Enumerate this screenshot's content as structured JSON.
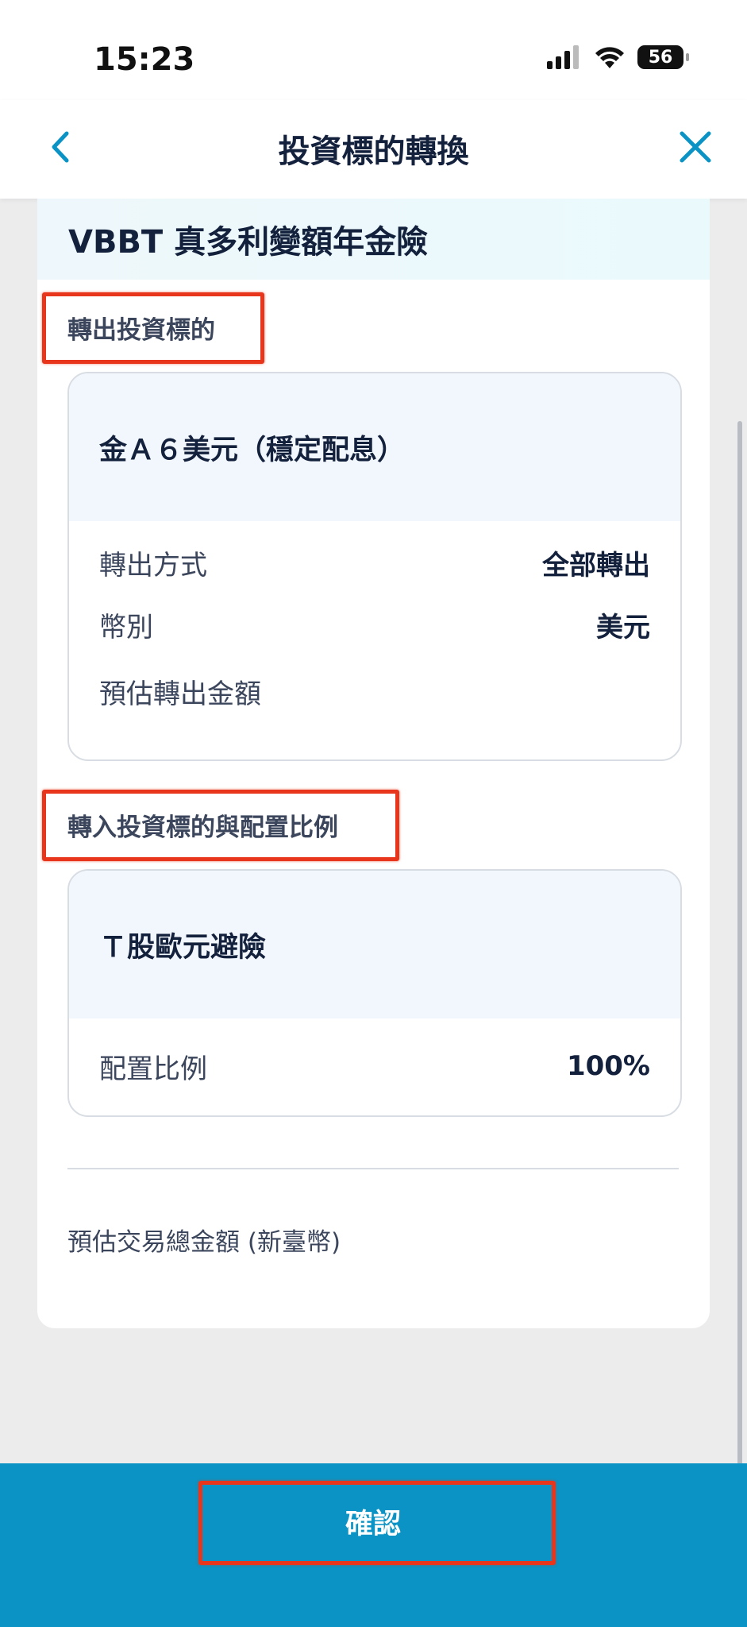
{
  "status_bar": {
    "time": "15:23",
    "battery": "56"
  },
  "nav": {
    "title": "投資標的轉換"
  },
  "product": {
    "name": "VBBT 真多利變額年金險"
  },
  "transfer_out": {
    "section_label": "轉出投資標的",
    "fund_name": "金Ａ６美元（穩定配息）",
    "rows": [
      {
        "label": "轉出方式",
        "value": "全部轉出"
      },
      {
        "label": "幣別",
        "value": "美元"
      },
      {
        "label": "預估轉出金額",
        "value": ""
      }
    ]
  },
  "transfer_in": {
    "section_label": "轉入投資標的與配置比例",
    "fund_name": "Ｔ股歐元避險",
    "rows": [
      {
        "label": "配置比例",
        "value": "100%"
      }
    ]
  },
  "total": {
    "label": "預估交易總金額 (新臺幣)"
  },
  "footer": {
    "confirm_label": "確認"
  },
  "colors": {
    "accent": "#0a93c4",
    "highlight": "#e8361c",
    "text": "#14213d"
  }
}
